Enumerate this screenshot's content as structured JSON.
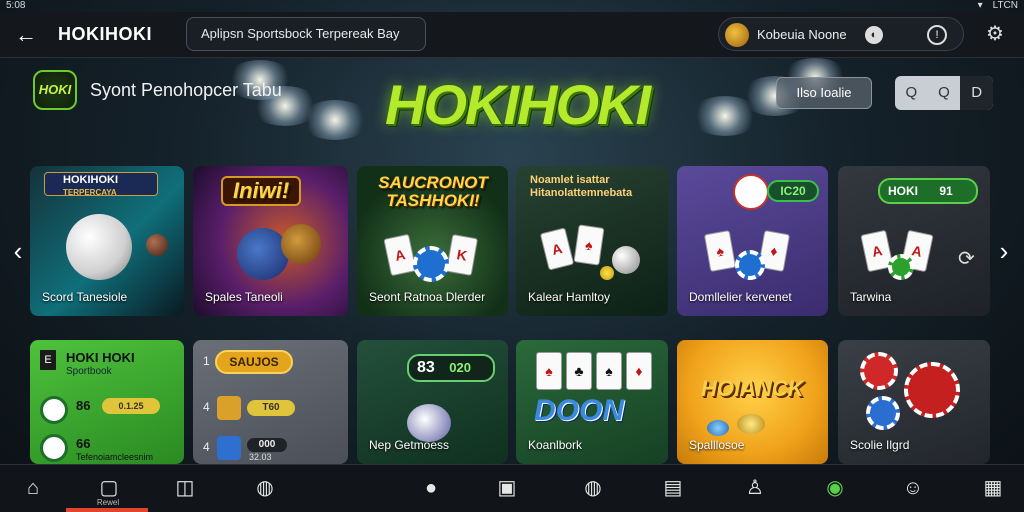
{
  "status_bar": {
    "time": "5:08",
    "right_text": "LTCN"
  },
  "top_bar": {
    "back_icon": "arrow-left-icon",
    "brand": "HOKIHOKI",
    "search_text": "Aplipsn Sportsbock Terpereak Bay",
    "user": {
      "name": "Kobeuia Noone"
    },
    "settings_icon": "gear-icon"
  },
  "hero": {
    "small_logo_text": "HOKI",
    "tagline": "Syont Penohopcer Tabu",
    "brand": "HOKIHOKI",
    "button_label": "Ilso  Ioalie",
    "controls": [
      "Q",
      "Q",
      "D"
    ]
  },
  "row1": [
    {
      "badge": "HOKIHOKI",
      "sub": "TERPERCAYA",
      "label": "Scord Tanesiole"
    },
    {
      "title": "Iniwi!",
      "label": "Spales Taneoli"
    },
    {
      "title": "SAUCRONOT TASHHOKI!",
      "label": "Seont Ratnoa Dlerder"
    },
    {
      "title": "Noamlet isattar",
      "sub": "Hitanolattemnebata",
      "label": "Kalear Hamltoy"
    },
    {
      "badge_value": "IC20",
      "label": "Domllelier kervenet"
    },
    {
      "badge_text": "HOKI",
      "badge_value": "91",
      "label": "Tarwina"
    }
  ],
  "row2": [
    {
      "title": "HOKI HOKI",
      "sub": "Sportbook",
      "lines": [
        {
          "value": "86",
          "badge": "0.1.25"
        },
        {
          "value": "66",
          "badge": ""
        }
      ],
      "footer": "Tefenoiamcleesnim"
    },
    {
      "rows": [
        {
          "rank": "1",
          "value": "SAUJOS"
        },
        {
          "rank": "4",
          "value": "T60"
        },
        {
          "rank": "4",
          "value": "000"
        }
      ],
      "footer": "32.03"
    },
    {
      "badge_left": "83",
      "badge_right": "020",
      "label": "Nep Getmoess"
    },
    {
      "title": "DOON",
      "label": "Koanlbork"
    },
    {
      "title": "HOIANCK",
      "label": "Spalllosoe"
    },
    {
      "label": "Scolie Ilgrd"
    }
  ],
  "nav": {
    "items": [
      "home-icon",
      "bookmark-icon",
      "chat-icon",
      "football-icon",
      "ball-icon",
      "document-icon",
      "football-icon",
      "calendar-icon",
      "person-icon",
      "soccer-icon",
      "profile-icon",
      "grid-icon"
    ],
    "active_label": "Rewel"
  },
  "colors": {
    "accent": "#b5ea2c",
    "active_nav": "#e2432d",
    "card_green": "#3aa830",
    "card_purple": "#6b4aa8",
    "card_orange": "#f0a21a"
  }
}
